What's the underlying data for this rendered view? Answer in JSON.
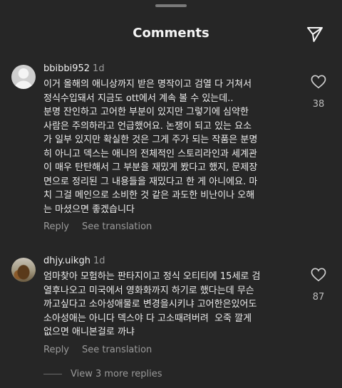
{
  "header": {
    "title": "Comments",
    "send_icon": "paper-plane-icon"
  },
  "comments": [
    {
      "username": "bbibbi952",
      "time": "1d",
      "avatar": "default-avatar-icon",
      "text": "이거 올해의 애니상까지 받은 명작이고 검열 다 거쳐서\n정식수입돼서 지금도 ott에서 계속 볼 수 있는데..\n분명 잔인하고 고어한 부분이 있지만 그렇기에 심약한\n사람은 주의하라고 언급했어요. 논쟁이 되고 있는 요소\n가 일부 있지만 확실한 것은 그게 주가 되는 작품은 분명\n히 아니고 덱스는 애니의 전체적인 스토리라인과 세계관\n이 매우 탄탄해서 그 부분을 재밌게 봤다고 했지, 문제장\n면으로 정리된 그 내용들을 재밌다고 한 게 아니에요. 마\n치 그걸 메인으로 소비한 것 같은 과도한 비난이나 오해\n는 마셨으면 좋겠습니다",
      "likes": "38",
      "reply_label": "Reply",
      "translate_label": "See translation"
    },
    {
      "username": "dhjy.uikgh",
      "time": "1d",
      "avatar": "photo-avatar",
      "text": "엄마찾아 모험하는 판타지이고 정식 오티티에 15세로 검\n열후나오고 미국에서 영화화까지 하기로 했다는데 무슨\n까고싶다고 소아성애물로 변경을시키냐 고어한은있어도\n소아성애는 아니다 덱스야 다 고소때려버려  오죽 깔게\n없으면 애니본걸로 까냐",
      "likes": "87",
      "reply_label": "Reply",
      "translate_label": "See translation"
    }
  ],
  "more_replies": "View 3 more replies",
  "colors": {
    "background": "#262626",
    "text": "#f5f5f5",
    "muted": "#9a9a9a"
  }
}
